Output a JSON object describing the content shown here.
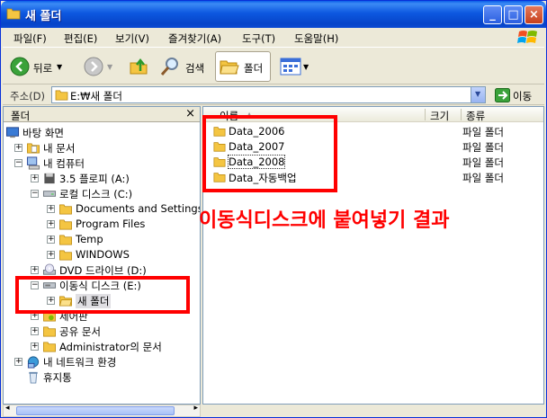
{
  "window": {
    "title": "새 폴더",
    "icon": "folder-icon",
    "controls": [
      "minimize-icon",
      "maximize-icon",
      "close-icon"
    ]
  },
  "menubar": {
    "items": [
      "파일(F)",
      "편집(E)",
      "보기(V)",
      "즐겨찾기(A)",
      "도구(T)",
      "도움말(H)"
    ]
  },
  "toolbar": {
    "back_label": "뒤로",
    "search_label": "검색",
    "folders_label": "폴더"
  },
  "addressbar": {
    "label": "주소(D)",
    "value": "E:₩새 폴더",
    "go_label": "이동"
  },
  "tree": {
    "header": "폴더",
    "close_glyph": "×",
    "items": [
      {
        "label": "바탕 화면",
        "icon": "desktop-icon",
        "level": 0,
        "expander": ""
      },
      {
        "label": "내 문서",
        "icon": "documents-icon",
        "level": 1,
        "expander": "+"
      },
      {
        "label": "내 컴퓨터",
        "icon": "computer-icon",
        "level": 1,
        "expander": "−"
      },
      {
        "label": "3.5 플로피 (A:)",
        "icon": "floppy-icon",
        "level": 2,
        "expander": "+"
      },
      {
        "label": "로컬 디스크 (C:)",
        "icon": "drive-icon",
        "level": 2,
        "expander": "−"
      },
      {
        "label": "Documents and Settings",
        "icon": "folder-icon",
        "level": 3,
        "expander": "+"
      },
      {
        "label": "Program Files",
        "icon": "folder-icon",
        "level": 3,
        "expander": "+"
      },
      {
        "label": "Temp",
        "icon": "folder-icon",
        "level": 3,
        "expander": "+"
      },
      {
        "label": "WINDOWS",
        "icon": "folder-icon",
        "level": 3,
        "expander": "+"
      },
      {
        "label": "DVD 드라이브 (D:)",
        "icon": "dvd-icon",
        "level": 2,
        "expander": "+"
      },
      {
        "label": "이동식 디스크 (E:)",
        "icon": "removable-disk-icon",
        "level": 2,
        "expander": "−"
      },
      {
        "label": "새 폴더",
        "icon": "open-folder-icon",
        "level": 3,
        "expander": "+",
        "selected": true
      },
      {
        "label": "제어판",
        "icon": "control-panel-icon",
        "level": 2,
        "expander": "+"
      },
      {
        "label": "공유 문서",
        "icon": "folder-icon",
        "level": 2,
        "expander": "+"
      },
      {
        "label": "Administrator의 문서",
        "icon": "folder-icon",
        "level": 2,
        "expander": "+"
      },
      {
        "label": "내 네트워크 환경",
        "icon": "network-icon",
        "level": 1,
        "expander": "+"
      },
      {
        "label": "휴지통",
        "icon": "recycle-bin-icon",
        "level": 1,
        "expander": ""
      }
    ]
  },
  "list": {
    "columns": [
      "이름",
      "크기",
      "종류"
    ],
    "rows": [
      {
        "name": "Data_2006",
        "type": "파일 폴더"
      },
      {
        "name": "Data_2007",
        "type": "파일 폴더"
      },
      {
        "name": "Data_2008",
        "type": "파일 폴더"
      },
      {
        "name": "Data_자동백업",
        "type": "파일 폴더"
      }
    ]
  },
  "annotation": {
    "text": "이동식디스크에 붙여넣기 결과",
    "color": "#ff0000"
  },
  "colors": {
    "titlebar": "#0a5ee8",
    "folder": "#f4c542",
    "selection": "#e0dfe3"
  }
}
